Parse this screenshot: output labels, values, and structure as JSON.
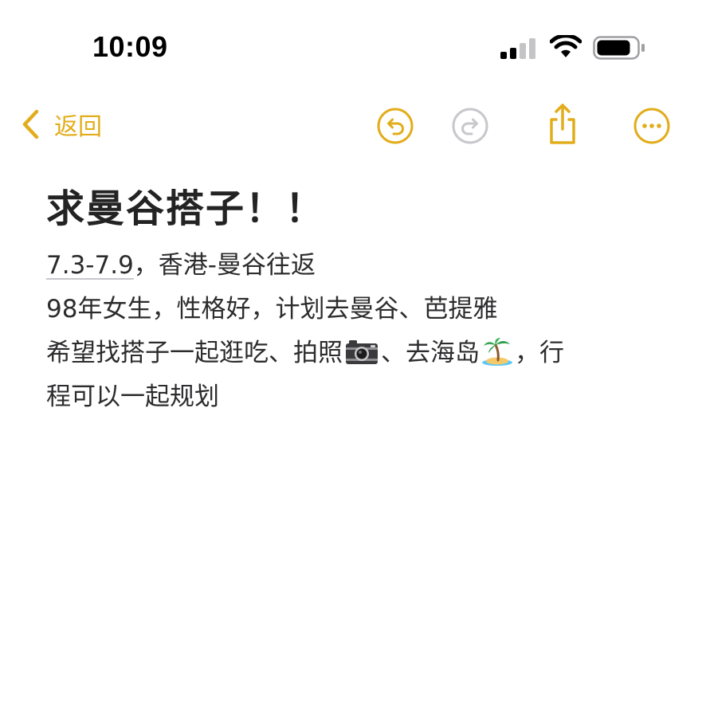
{
  "status_bar": {
    "time": "10:09",
    "signal_icon": "cellular-signal-icon",
    "wifi_icon": "wifi-icon",
    "battery_icon": "battery-icon"
  },
  "nav": {
    "back_label": "返回",
    "accent_color": "#e2ad1b",
    "disabled_color": "#c7c7cc",
    "icons": [
      "chevron-left-icon",
      "undo-icon",
      "redo-icon",
      "share-icon",
      "more-icon"
    ]
  },
  "note": {
    "title": "求曼谷搭子！！",
    "date_range": "7.3-7.9",
    "line1_rest": "，香港-曼谷往返",
    "line2": "98年女生，性格好，计划去曼谷、芭提雅",
    "line3_a": "希望找搭子一起逛吃、拍照",
    "line3_b": "、去海岛",
    "line3_c": "，行",
    "line4": "程可以一起规划",
    "emoji_camera": "camera-icon",
    "emoji_island": "desert-island-icon"
  }
}
